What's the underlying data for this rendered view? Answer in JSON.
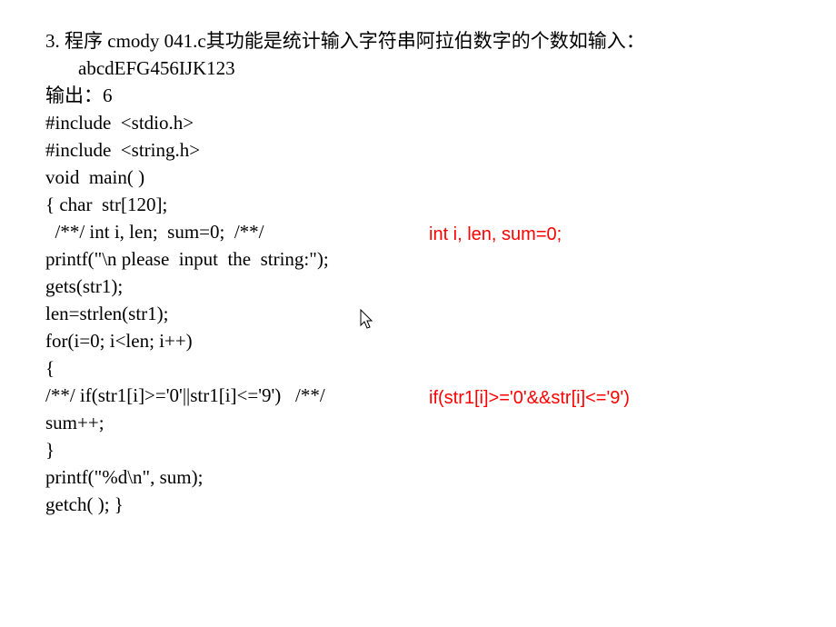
{
  "question": {
    "number": "3.",
    "text_line1": "程序 cmody 041.c其功能是统计输入字符串阿拉伯数字的个数如输入：",
    "text_line2": "abcdEFG456IJK123",
    "output_label": "输出：6"
  },
  "code": {
    "l1": "#include  <stdio.h>",
    "l2": "#include  <string.h>",
    "l3": "void  main( )",
    "l4": "{ char  str[120];",
    "l5": "  /**/ int i, len;  sum=0;  /**/",
    "l6": "printf(\"\\n please  input  the  string:\");",
    "l7": "gets(str1);",
    "l8": "len=strlen(str1);",
    "l9": "for(i=0; i<len; i++)",
    "l10": "{",
    "l11": "/**/ if(str1[i]>='0'||str1[i]<='9')   /**/",
    "l12": "sum++;",
    "l13": "}",
    "l14": "printf(\"%d\\n\", sum);",
    "l15": "getch( ); }"
  },
  "annotations": {
    "a1": "int  i,  len, sum=0;",
    "a2": "if(str1[i]>='0'&&str[i]<='9')"
  }
}
